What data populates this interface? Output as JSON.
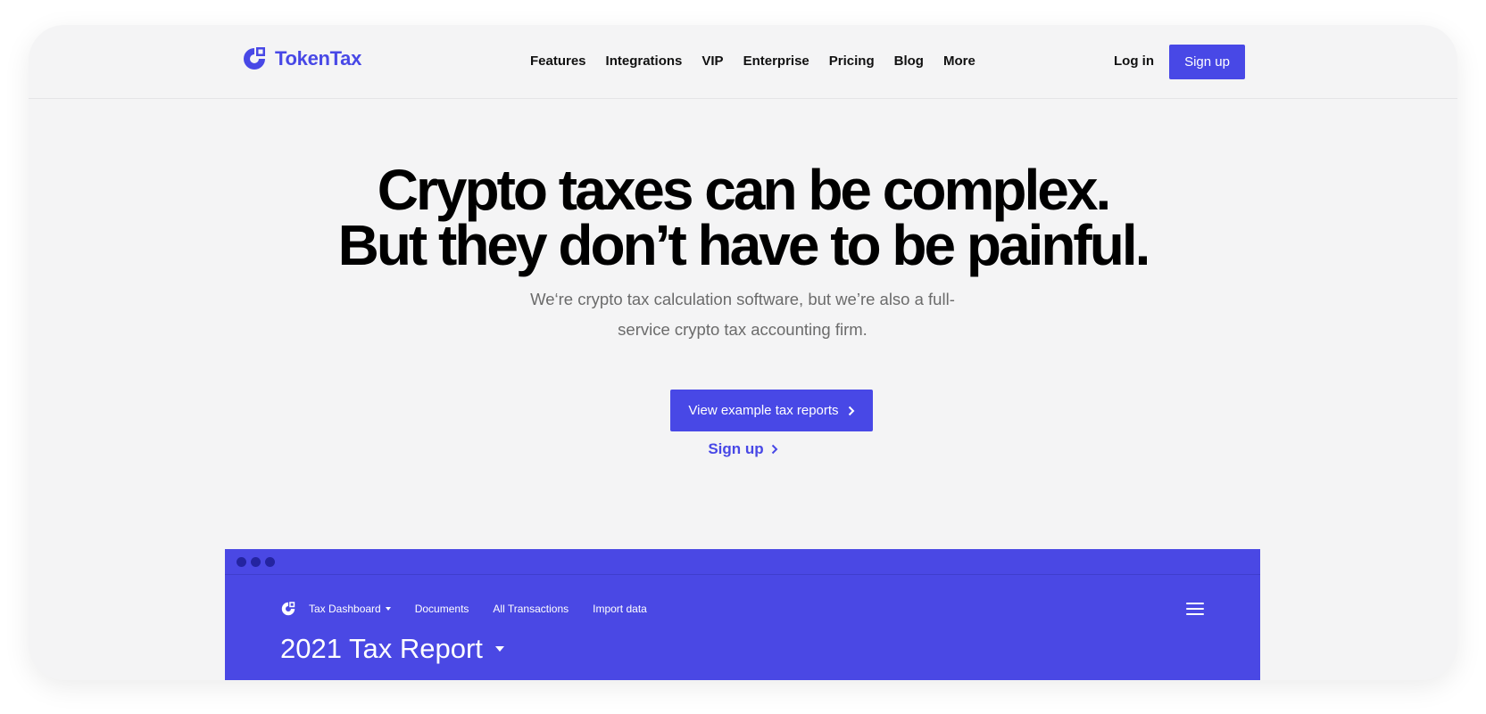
{
  "brand": {
    "name": "TokenTax",
    "color": "#4848e6",
    "icon": "tokentax-logo-icon"
  },
  "nav": {
    "items": [
      "Features",
      "Integrations",
      "VIP",
      "Enterprise",
      "Pricing",
      "Blog",
      "More"
    ],
    "login_label": "Log in",
    "signup_label": "Sign up"
  },
  "hero": {
    "title_line1": "Crypto taxes can be complex.",
    "title_line2": "But they don’t have to be painful.",
    "subtitle": "We‘re crypto tax calculation software, but we’re also a full-service crypto tax accounting firm.",
    "cta_primary": "View example tax reports",
    "cta_secondary": "Sign up"
  },
  "preview": {
    "nav": {
      "dashboard_label": "Tax Dashboard",
      "documents_label": "Documents",
      "transactions_label": "All Transactions",
      "import_label": "Import data"
    },
    "report_title": "2021 Tax Report",
    "accent": "#4a48e4"
  }
}
